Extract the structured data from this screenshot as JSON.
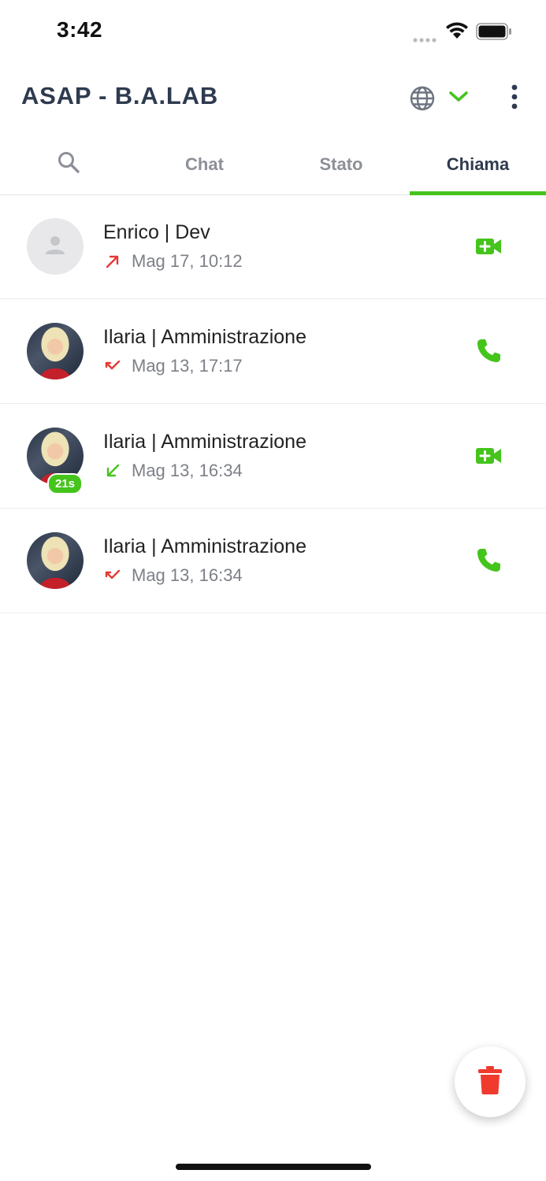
{
  "status_bar": {
    "time": "3:42"
  },
  "header": {
    "title": "ASAP - B.A.LAB",
    "icons": [
      "globe-icon",
      "chevron-down-icon",
      "more-vertical-icon"
    ]
  },
  "tabs": [
    {
      "label": "",
      "icon": "search-icon"
    },
    {
      "label": "Chat"
    },
    {
      "label": "Stato"
    },
    {
      "label": "Chiama",
      "active": true
    }
  ],
  "calls": [
    {
      "name": "Enrico | Dev",
      "time": "Mag 17, 10:12",
      "direction": "outgoing",
      "type": "video",
      "avatar": "placeholder",
      "duration": ""
    },
    {
      "name": "Ilaria | Amministrazione",
      "time": "Mag 13, 17:17",
      "direction": "missed",
      "type": "voice",
      "avatar": "photo",
      "duration": ""
    },
    {
      "name": "Ilaria | Amministrazione",
      "time": "Mag 13, 16:34",
      "direction": "incoming",
      "type": "video",
      "avatar": "photo",
      "duration": "21s"
    },
    {
      "name": "Ilaria | Amministrazione",
      "time": "Mag 13, 16:34",
      "direction": "missed",
      "type": "voice",
      "avatar": "photo",
      "duration": ""
    }
  ],
  "fab": {
    "icon": "trash-icon"
  },
  "colors": {
    "accent": "#45c41c",
    "title": "#2e3a4f",
    "missed": "#e53935",
    "delete": "#f03a2e"
  }
}
